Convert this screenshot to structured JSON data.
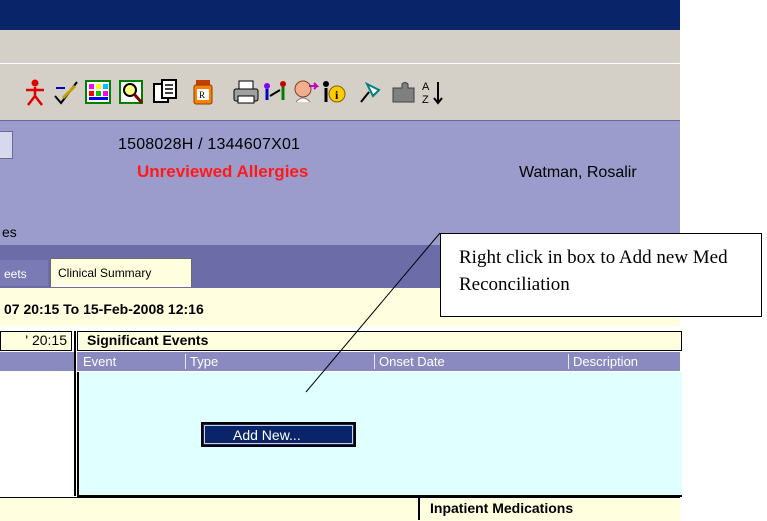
{
  "banner": {
    "mrn": "1508028H / 1344607X01",
    "allergy_alert": "Unreviewed Allergies",
    "patient_name": "Watman, Rosalir",
    "left_fragment": "es"
  },
  "tabs": {
    "sheets_fragment": "eets",
    "clinical_summary": "Clinical Summary"
  },
  "date_range": "07 20:15 To 15-Feb-2008 12:16",
  "grid": {
    "time_fragment": "' 20:15",
    "section_title": "Significant Events",
    "columns": [
      "Event",
      "Type",
      "Onset Date",
      "Description"
    ],
    "add_new_label": "Add New..."
  },
  "bottom_section": "Inpatient Medications",
  "callout": {
    "text": "Right click in box to Add new Med Reconciliation"
  },
  "toolbar_icons": [
    "person-icon",
    "pen-check-icon",
    "color-grid-icon",
    "magnifier-icon",
    "clipboard-icon",
    "rx-bottle-icon",
    "printer-icon",
    "people-link-icon",
    "doctor-arrow-icon",
    "info-person-icon",
    "pin-icon",
    "puzzle-icon",
    "sort-az-icon"
  ],
  "colors": {
    "titlebar": "#0a246a",
    "banner": "#9c9ccc",
    "allergy_red": "#ff1a1a",
    "grid_body": "#e0ffff",
    "panel_yellow": "#ffffe0"
  }
}
